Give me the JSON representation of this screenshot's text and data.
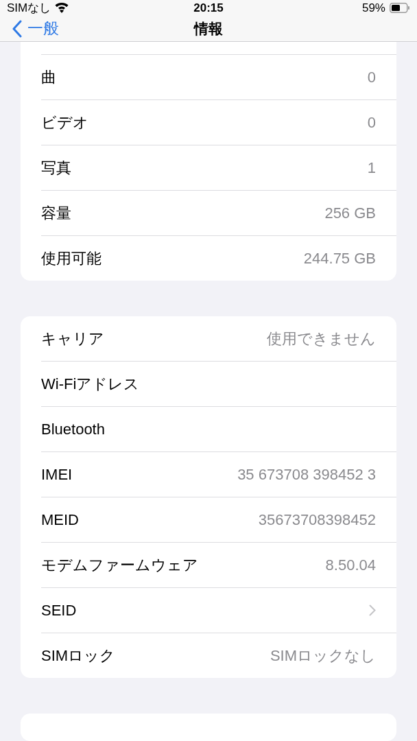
{
  "status_bar": {
    "carrier": "SIMなし",
    "time": "20:15",
    "battery": "59%"
  },
  "nav": {
    "back": "一般",
    "title": "情報"
  },
  "groups": [
    {
      "rows": [
        {
          "kind": "value",
          "label": "曲",
          "value": "0"
        },
        {
          "kind": "value",
          "label": "ビデオ",
          "value": "0"
        },
        {
          "kind": "value",
          "label": "写真",
          "value": "1"
        },
        {
          "kind": "value",
          "label": "容量",
          "value": "256 GB"
        },
        {
          "kind": "value",
          "label": "使用可能",
          "value": "244.75 GB"
        }
      ]
    },
    {
      "rows": [
        {
          "kind": "value",
          "label": "キャリア",
          "value": "使用できません"
        },
        {
          "kind": "value",
          "label": "Wi-Fiアドレス"
        },
        {
          "kind": "value",
          "label": "Bluetooth"
        },
        {
          "kind": "value",
          "label": "IMEI",
          "value": "35 673708 398452 3"
        },
        {
          "kind": "value",
          "label": "MEID",
          "value": "35673708398452"
        },
        {
          "kind": "value",
          "label": "モデムファームウェア",
          "value": "8.50.04"
        },
        {
          "kind": "disclosure",
          "label": "SEID"
        },
        {
          "kind": "value",
          "label": "SIMロック",
          "value": "SIMロックなし"
        }
      ]
    }
  ]
}
